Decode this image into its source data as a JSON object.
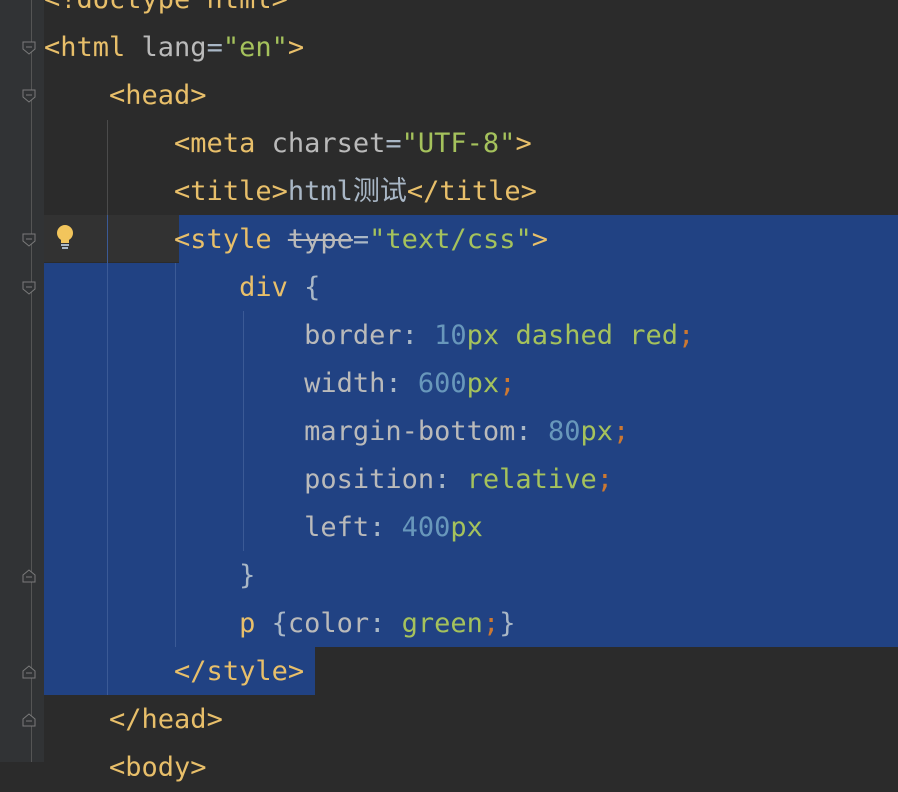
{
  "editor": {
    "lines": [
      {
        "indent": "",
        "parts": [
          {
            "t": "<!doctype html>",
            "c": "tag"
          }
        ]
      },
      {
        "indent": "",
        "parts": [
          {
            "t": "<html",
            "c": "tag"
          },
          {
            "t": " lang",
            "c": "attr"
          },
          {
            "t": "=",
            "c": "plain"
          },
          {
            "t": "\"en\"",
            "c": "val"
          },
          {
            "t": ">",
            "c": "tag"
          }
        ]
      },
      {
        "indent": "    ",
        "parts": [
          {
            "t": "<head>",
            "c": "tag"
          }
        ]
      },
      {
        "indent": "        ",
        "parts": [
          {
            "t": "<meta",
            "c": "tag"
          },
          {
            "t": " charset",
            "c": "attr"
          },
          {
            "t": "=",
            "c": "plain"
          },
          {
            "t": "\"UTF-8\"",
            "c": "val"
          },
          {
            "t": ">",
            "c": "tag"
          }
        ]
      },
      {
        "indent": "        ",
        "parts": [
          {
            "t": "<title>",
            "c": "tag"
          },
          {
            "t": "html测试",
            "c": "plain"
          },
          {
            "t": "</title>",
            "c": "tag"
          }
        ]
      },
      {
        "indent": "        ",
        "parts": [
          {
            "t": "<style",
            "c": "tag"
          },
          {
            "t": " ",
            "c": "plain"
          },
          {
            "t": "type",
            "c": "strike"
          },
          {
            "t": "=",
            "c": "plain"
          },
          {
            "t": "\"text/css\"",
            "c": "val"
          },
          {
            "t": ">",
            "c": "tag"
          }
        ]
      },
      {
        "indent": "            ",
        "parts": [
          {
            "t": "div",
            "c": "sel-c"
          },
          {
            "t": " {",
            "c": "plain"
          }
        ]
      },
      {
        "indent": "                ",
        "parts": [
          {
            "t": "border",
            "c": "prop"
          },
          {
            "t": ": ",
            "c": "plain"
          },
          {
            "t": "10",
            "c": "num"
          },
          {
            "t": "px",
            "c": "unit"
          },
          {
            "t": " dashed red",
            "c": "val"
          },
          {
            "t": ";",
            "c": "semi"
          }
        ]
      },
      {
        "indent": "                ",
        "parts": [
          {
            "t": "width",
            "c": "prop"
          },
          {
            "t": ": ",
            "c": "plain"
          },
          {
            "t": "600",
            "c": "num"
          },
          {
            "t": "px",
            "c": "unit"
          },
          {
            "t": ";",
            "c": "semi"
          }
        ]
      },
      {
        "indent": "                ",
        "parts": [
          {
            "t": "margin-bottom",
            "c": "prop"
          },
          {
            "t": ": ",
            "c": "plain"
          },
          {
            "t": "80",
            "c": "num"
          },
          {
            "t": "px",
            "c": "unit"
          },
          {
            "t": ";",
            "c": "semi"
          }
        ]
      },
      {
        "indent": "                ",
        "parts": [
          {
            "t": "position",
            "c": "prop"
          },
          {
            "t": ": ",
            "c": "plain"
          },
          {
            "t": "relative",
            "c": "val"
          },
          {
            "t": ";",
            "c": "semi"
          }
        ]
      },
      {
        "indent": "                ",
        "parts": [
          {
            "t": "left",
            "c": "prop"
          },
          {
            "t": ": ",
            "c": "plain"
          },
          {
            "t": "400",
            "c": "num"
          },
          {
            "t": "px",
            "c": "unit"
          }
        ]
      },
      {
        "indent": "            ",
        "parts": [
          {
            "t": "}",
            "c": "plain"
          }
        ]
      },
      {
        "indent": "            ",
        "parts": [
          {
            "t": "p",
            "c": "sel-c"
          },
          {
            "t": " {",
            "c": "plain"
          },
          {
            "t": "color",
            "c": "prop"
          },
          {
            "t": ": ",
            "c": "plain"
          },
          {
            "t": "green",
            "c": "val"
          },
          {
            "t": ";",
            "c": "semi"
          },
          {
            "t": "}",
            "c": "plain"
          }
        ]
      },
      {
        "indent": "        ",
        "parts": [
          {
            "t": "</style>",
            "c": "tag"
          }
        ]
      },
      {
        "indent": "    ",
        "parts": [
          {
            "t": "</head>",
            "c": "tag"
          }
        ]
      },
      {
        "indent": "    ",
        "parts": [
          {
            "t": "<body>",
            "c": "tag"
          }
        ]
      }
    ],
    "icons": {
      "intention": "lightbulb-icon",
      "fold": "fold-marker-icon"
    },
    "colors": {
      "background": "#2b2b2b",
      "selection": "#214283",
      "tag": "#e8bf6a",
      "string": "#a5c25c",
      "number": "#6897bb",
      "semicolon": "#cc7832"
    }
  }
}
